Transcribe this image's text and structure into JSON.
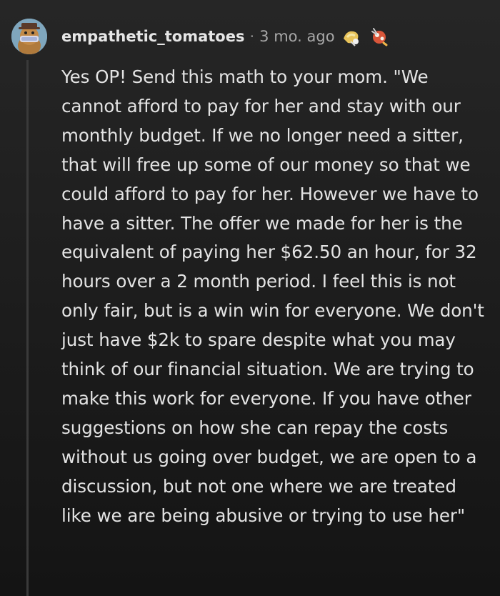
{
  "comment": {
    "username": "empathetic_tomatoes",
    "separator": "·",
    "timestamp": "3 mo. ago",
    "body": "Yes OP! Send this math to your mom. \"We cannot afford to pay for her and stay with our monthly budget. If we no longer need a sitter, that will free up some of our money so that we could afford to pay for her. However we have to have a sitter. The offer we made for her is the equivalent of paying her $62.50 an hour, for 32 hours over a 2 month period. I feel this is not only fair, but is a win win for everyone. We don't just have $2k to spare despite what you may think of our financial situation. We are trying to make this work for everyone. If you have other suggestions on how she can repay the costs without us going over budget, we are open to a discussion, but not one where we are treated like we are being abusive or trying to use her\"",
    "avatar_icon": "snoo-avatar-icon",
    "awards": [
      "award-icon-1",
      "award-icon-2"
    ]
  },
  "colors": {
    "background": "#1b1b1b",
    "text": "#e3e3e3",
    "username": "#e6e6e6",
    "timestamp": "#a8a8a8",
    "thread_line": "#3a3a3a"
  }
}
